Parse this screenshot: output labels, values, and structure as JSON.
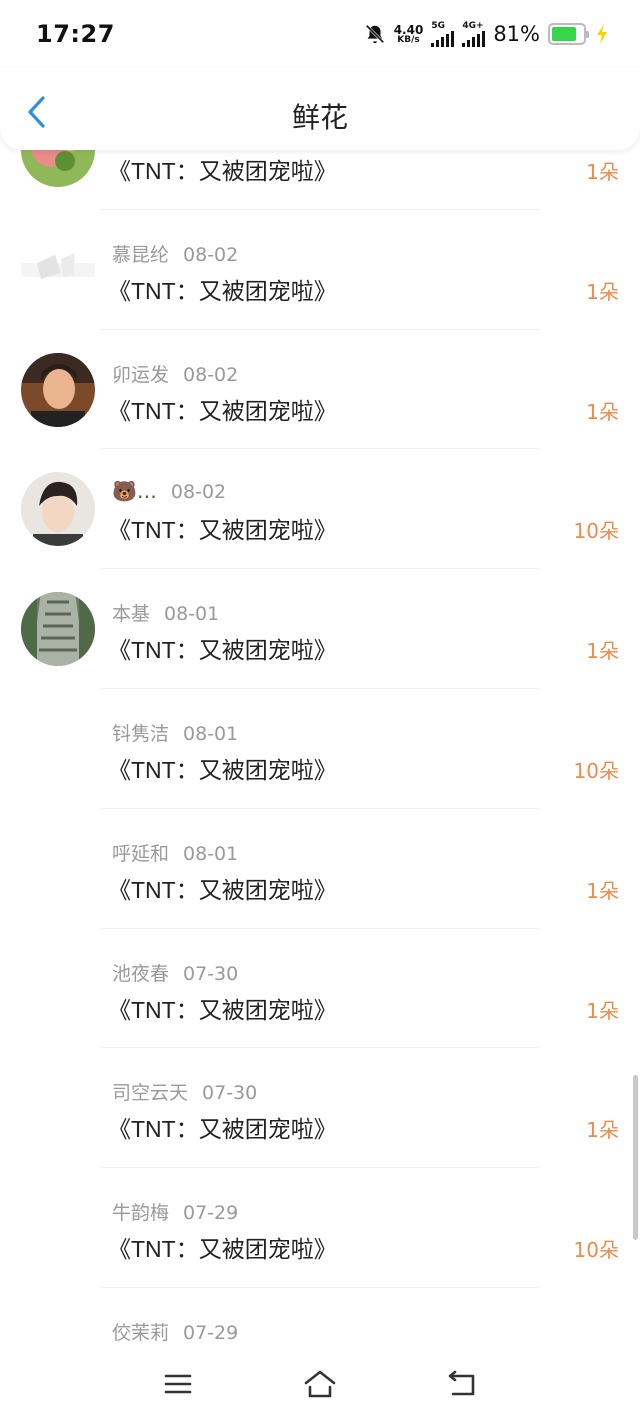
{
  "status": {
    "time": "17:27",
    "net_speed": "4.40",
    "net_unit": "KB/s",
    "sim1_tag": "5G",
    "sim2_tag": "4G+",
    "battery_pct": "81%",
    "battery_level": 0.81,
    "battery_color": "#37d64a"
  },
  "header": {
    "title": "鲜花",
    "back_icon": "chevron-left-icon",
    "accent": "#2f8fe8"
  },
  "rows": [
    {
      "name": "",
      "date": "",
      "book": "《TNT：又被团宠啦》",
      "amount": "1朵"
    },
    {
      "name": "慕昆纶",
      "date": "08-02",
      "book": "《TNT：又被团宠啦》",
      "amount": "1朵"
    },
    {
      "name": "卯运发",
      "date": "08-02",
      "book": "《TNT：又被团宠啦》",
      "amount": "1朵"
    },
    {
      "name": "🐻…",
      "date": "08-02",
      "book": "《TNT：又被团宠啦》",
      "amount": "10朵"
    },
    {
      "name": "本基",
      "date": "08-01",
      "book": "《TNT：又被团宠啦》",
      "amount": "1朵"
    },
    {
      "name": "钭隽洁",
      "date": "08-01",
      "book": "《TNT：又被团宠啦》",
      "amount": "10朵"
    },
    {
      "name": "呼延和",
      "date": "08-01",
      "book": "《TNT：又被团宠啦》",
      "amount": "1朵"
    },
    {
      "name": "池夜春",
      "date": "07-30",
      "book": "《TNT：又被团宠啦》",
      "amount": "1朵"
    },
    {
      "name": "司空云天",
      "date": "07-30",
      "book": "《TNT：又被团宠啦》",
      "amount": "1朵"
    },
    {
      "name": "牛韵梅",
      "date": "07-29",
      "book": "《TNT：又被团宠啦》",
      "amount": "10朵"
    },
    {
      "name": "佼茉莉",
      "date": "07-29",
      "book": "",
      "amount": ""
    }
  ],
  "colors": {
    "amount": "#f08a4b",
    "meta": "#9a9a9a"
  },
  "navbar": {
    "menu_icon": "menu-icon",
    "home_icon": "home-icon",
    "back_icon": "back-icon"
  }
}
